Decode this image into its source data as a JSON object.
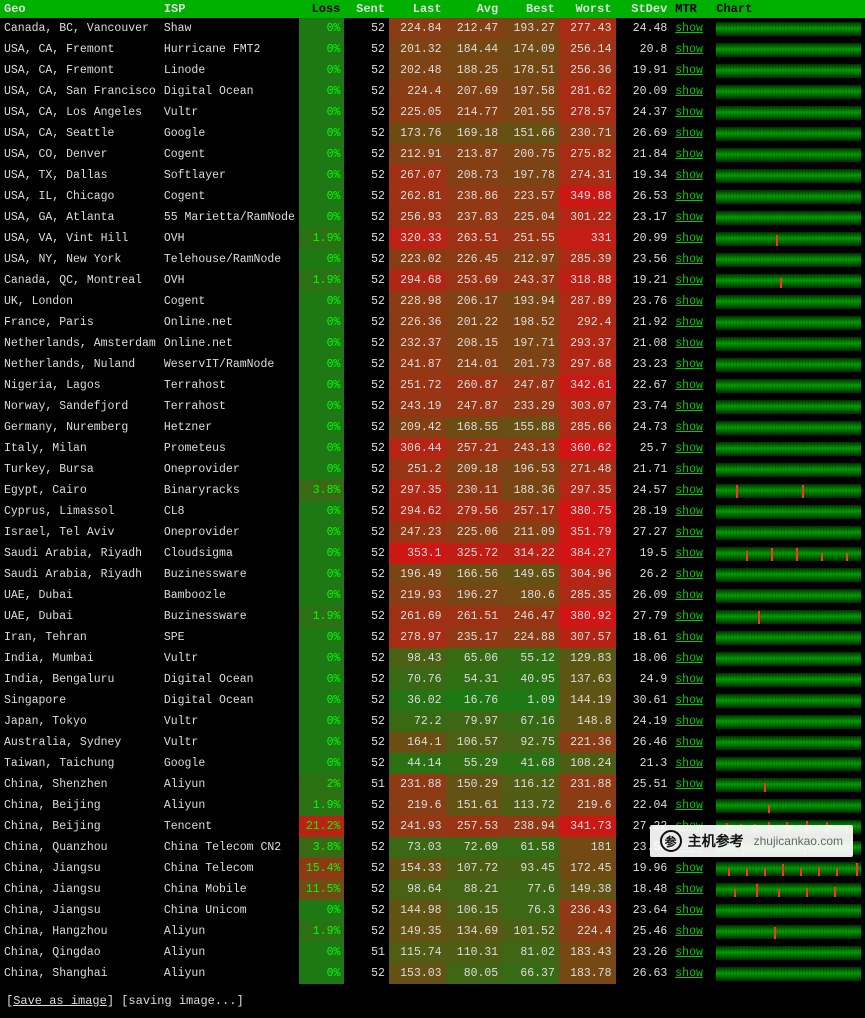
{
  "headers": {
    "geo": "Geo",
    "isp": "ISP",
    "loss": "Loss",
    "sent": "Sent",
    "last": "Last",
    "avg": "Avg",
    "best": "Best",
    "worst": "Worst",
    "stdev": "StDev",
    "mtr": "MTR",
    "chart": "Chart"
  },
  "mtr_label": "show",
  "footer": {
    "save": "Save as image",
    "status": "[saving image...]"
  },
  "watermark": {
    "name": "主机参考",
    "url": "zhujicankao.com"
  },
  "heat": {
    "loss": {
      "lo": 0,
      "hi": 25
    },
    "lat": {
      "lo": 20,
      "hi": 360
    }
  },
  "rows": [
    {
      "geo": "Canada, BC, Vancouver",
      "isp": "Shaw",
      "loss": "0%",
      "sent": "52",
      "last": "224.84",
      "avg": "212.47",
      "best": "193.27",
      "worst": "277.43",
      "stdev": "24.48",
      "spikes": []
    },
    {
      "geo": "USA, CA, Fremont",
      "isp": "Hurricane FMT2",
      "loss": "0%",
      "sent": "52",
      "last": "201.32",
      "avg": "184.44",
      "best": "174.09",
      "worst": "256.14",
      "stdev": "20.8",
      "spikes": []
    },
    {
      "geo": "USA, CA, Fremont",
      "isp": "Linode",
      "loss": "0%",
      "sent": "52",
      "last": "202.48",
      "avg": "188.25",
      "best": "178.51",
      "worst": "256.36",
      "stdev": "19.91",
      "spikes": []
    },
    {
      "geo": "USA, CA, San Francisco",
      "isp": "Digital Ocean",
      "loss": "0%",
      "sent": "52",
      "last": "224.4",
      "avg": "207.69",
      "best": "197.58",
      "worst": "281.62",
      "stdev": "20.09",
      "spikes": []
    },
    {
      "geo": "USA, CA, Los Angeles",
      "isp": "Vultr",
      "loss": "0%",
      "sent": "52",
      "last": "225.05",
      "avg": "214.77",
      "best": "201.55",
      "worst": "278.57",
      "stdev": "24.37",
      "spikes": []
    },
    {
      "geo": "USA, CA, Seattle",
      "isp": "Google",
      "loss": "0%",
      "sent": "52",
      "last": "173.76",
      "avg": "169.18",
      "best": "151.66",
      "worst": "230.71",
      "stdev": "26.69",
      "spikes": []
    },
    {
      "geo": "USA, CO, Denver",
      "isp": "Cogent",
      "loss": "0%",
      "sent": "52",
      "last": "212.91",
      "avg": "213.87",
      "best": "200.75",
      "worst": "275.82",
      "stdev": "21.84",
      "spikes": []
    },
    {
      "geo": "USA, TX, Dallas",
      "isp": "Softlayer",
      "loss": "0%",
      "sent": "52",
      "last": "267.07",
      "avg": "208.73",
      "best": "197.78",
      "worst": "274.31",
      "stdev": "19.34",
      "spikes": []
    },
    {
      "geo": "USA, IL, Chicago",
      "isp": "Cogent",
      "loss": "0%",
      "sent": "52",
      "last": "262.81",
      "avg": "238.86",
      "best": "223.57",
      "worst": "349.88",
      "stdev": "26.53",
      "spikes": []
    },
    {
      "geo": "USA, GA, Atlanta",
      "isp": "55 Marietta/RamNode",
      "loss": "0%",
      "sent": "52",
      "last": "256.93",
      "avg": "237.83",
      "best": "225.04",
      "worst": "301.22",
      "stdev": "23.17",
      "spikes": []
    },
    {
      "geo": "USA, VA, Vint Hill",
      "isp": "OVH",
      "loss": "1.9%",
      "sent": "52",
      "last": "320.33",
      "avg": "263.51",
      "best": "251.55",
      "worst": "331",
      "stdev": "20.99",
      "spikes": [
        60
      ]
    },
    {
      "geo": "USA, NY, New York",
      "isp": "Telehouse/RamNode",
      "loss": "0%",
      "sent": "52",
      "last": "223.02",
      "avg": "226.45",
      "best": "212.97",
      "worst": "285.39",
      "stdev": "23.56",
      "spikes": []
    },
    {
      "geo": "Canada, QC, Montreal",
      "isp": "OVH",
      "loss": "1.9%",
      "sent": "52",
      "last": "294.68",
      "avg": "253.69",
      "best": "243.37",
      "worst": "318.88",
      "stdev": "19.21",
      "spikes": [
        64
      ]
    },
    {
      "geo": "UK, London",
      "isp": "Cogent",
      "loss": "0%",
      "sent": "52",
      "last": "228.98",
      "avg": "206.17",
      "best": "193.94",
      "worst": "287.89",
      "stdev": "23.76",
      "spikes": []
    },
    {
      "geo": "France, Paris",
      "isp": "Online.net",
      "loss": "0%",
      "sent": "52",
      "last": "226.36",
      "avg": "201.22",
      "best": "198.52",
      "worst": "292.4",
      "stdev": "21.92",
      "spikes": []
    },
    {
      "geo": "Netherlands, Amsterdam",
      "isp": "Online.net",
      "loss": "0%",
      "sent": "52",
      "last": "232.37",
      "avg": "208.15",
      "best": "197.71",
      "worst": "293.37",
      "stdev": "21.08",
      "spikes": []
    },
    {
      "geo": "Netherlands, Nuland",
      "isp": "WeservIT/RamNode",
      "loss": "0%",
      "sent": "52",
      "last": "241.87",
      "avg": "214.01",
      "best": "201.73",
      "worst": "297.68",
      "stdev": "23.23",
      "spikes": []
    },
    {
      "geo": "Nigeria, Lagos",
      "isp": "Terrahost",
      "loss": "0%",
      "sent": "52",
      "last": "251.72",
      "avg": "260.87",
      "best": "247.87",
      "worst": "342.61",
      "stdev": "22.67",
      "spikes": []
    },
    {
      "geo": "Norway, Sandefjord",
      "isp": "Terrahost",
      "loss": "0%",
      "sent": "52",
      "last": "243.19",
      "avg": "247.87",
      "best": "233.29",
      "worst": "303.07",
      "stdev": "23.74",
      "spikes": []
    },
    {
      "geo": "Germany, Nuremberg",
      "isp": "Hetzner",
      "loss": "0%",
      "sent": "52",
      "last": "209.42",
      "avg": "168.55",
      "best": "155.88",
      "worst": "285.66",
      "stdev": "24.73",
      "spikes": []
    },
    {
      "geo": "Italy, Milan",
      "isp": "Prometeus",
      "loss": "0%",
      "sent": "52",
      "last": "306.44",
      "avg": "257.21",
      "best": "243.13",
      "worst": "360.62",
      "stdev": "25.7",
      "spikes": [
        158
      ]
    },
    {
      "geo": "Turkey, Bursa",
      "isp": "Oneprovider",
      "loss": "0%",
      "sent": "52",
      "last": "251.2",
      "avg": "209.18",
      "best": "196.53",
      "worst": "271.48",
      "stdev": "21.71",
      "spikes": []
    },
    {
      "geo": "Egypt, Cairo",
      "isp": "Binaryracks",
      "loss": "3.8%",
      "sent": "52",
      "last": "297.35",
      "avg": "230.11",
      "best": "188.36",
      "worst": "297.35",
      "stdev": "24.57",
      "spikes": [
        20,
        86
      ]
    },
    {
      "geo": "Cyprus, Limassol",
      "isp": "CL8",
      "loss": "0%",
      "sent": "52",
      "last": "294.62",
      "avg": "279.56",
      "best": "257.17",
      "worst": "380.75",
      "stdev": "28.19",
      "spikes": []
    },
    {
      "geo": "Israel, Tel Aviv",
      "isp": "Oneprovider",
      "loss": "0%",
      "sent": "52",
      "last": "247.23",
      "avg": "225.06",
      "best": "211.09",
      "worst": "351.79",
      "stdev": "27.27",
      "spikes": []
    },
    {
      "geo": "Saudi Arabia, Riyadh",
      "isp": "Cloudsigma",
      "loss": "0%",
      "sent": "52",
      "last": "353.1",
      "avg": "325.72",
      "best": "314.22",
      "worst": "384.27",
      "stdev": "19.5",
      "spikes": [
        30,
        55,
        80,
        105,
        130
      ]
    },
    {
      "geo": "Saudi Arabia, Riyadh",
      "isp": "Buzinessware",
      "loss": "0%",
      "sent": "52",
      "last": "196.49",
      "avg": "166.56",
      "best": "149.65",
      "worst": "304.96",
      "stdev": "26.2",
      "spikes": []
    },
    {
      "geo": "UAE, Dubai",
      "isp": "Bamboozle",
      "loss": "0%",
      "sent": "52",
      "last": "219.93",
      "avg": "196.27",
      "best": "180.6",
      "worst": "285.35",
      "stdev": "26.09",
      "spikes": []
    },
    {
      "geo": "UAE, Dubai",
      "isp": "Buzinessware",
      "loss": "1.9%",
      "sent": "52",
      "last": "261.69",
      "avg": "261.51",
      "best": "246.47",
      "worst": "380.92",
      "stdev": "27.79",
      "spikes": [
        42
      ]
    },
    {
      "geo": "Iran, Tehran",
      "isp": "SPE",
      "loss": "0%",
      "sent": "52",
      "last": "278.97",
      "avg": "235.17",
      "best": "224.88",
      "worst": "307.57",
      "stdev": "18.61",
      "spikes": []
    },
    {
      "geo": "India, Mumbai",
      "isp": "Vultr",
      "loss": "0%",
      "sent": "52",
      "last": "98.43",
      "avg": "65.06",
      "best": "55.12",
      "worst": "129.83",
      "stdev": "18.06",
      "spikes": []
    },
    {
      "geo": "India, Bengaluru",
      "isp": "Digital Ocean",
      "loss": "0%",
      "sent": "52",
      "last": "70.76",
      "avg": "54.31",
      "best": "40.95",
      "worst": "137.63",
      "stdev": "24.9",
      "spikes": []
    },
    {
      "geo": "Singapore",
      "isp": "Digital Ocean",
      "loss": "0%",
      "sent": "52",
      "last": "36.02",
      "avg": "16.76",
      "best": "1.09",
      "worst": "144.19",
      "stdev": "30.61",
      "spikes": []
    },
    {
      "geo": "Japan, Tokyo",
      "isp": "Vultr",
      "loss": "0%",
      "sent": "52",
      "last": "72.2",
      "avg": "79.97",
      "best": "67.16",
      "worst": "148.8",
      "stdev": "24.19",
      "spikes": []
    },
    {
      "geo": "Australia, Sydney",
      "isp": "Vultr",
      "loss": "0%",
      "sent": "52",
      "last": "164.1",
      "avg": "106.57",
      "best": "92.75",
      "worst": "221.36",
      "stdev": "26.46",
      "spikes": []
    },
    {
      "geo": "Taiwan, Taichung",
      "isp": "Google",
      "loss": "0%",
      "sent": "52",
      "last": "44.14",
      "avg": "55.29",
      "best": "41.68",
      "worst": "108.24",
      "stdev": "21.3",
      "spikes": []
    },
    {
      "geo": "China, Shenzhen",
      "isp": "Aliyun",
      "loss": "2%",
      "sent": "51",
      "last": "231.88",
      "avg": "150.29",
      "best": "116.12",
      "worst": "231.88",
      "stdev": "25.51",
      "spikes": [
        48
      ]
    },
    {
      "geo": "China, Beijing",
      "isp": "Aliyun",
      "loss": "1.9%",
      "sent": "52",
      "last": "219.6",
      "avg": "151.61",
      "best": "113.72",
      "worst": "219.6",
      "stdev": "22.04",
      "spikes": [
        52
      ]
    },
    {
      "geo": "China, Beijing",
      "isp": "Tencent",
      "loss": "21.2%",
      "sent": "52",
      "last": "241.93",
      "avg": "257.53",
      "best": "238.94",
      "worst": "341.73",
      "stdev": "27.22",
      "spikes": [
        10,
        24,
        38,
        52,
        70,
        90,
        110,
        130,
        150
      ]
    },
    {
      "geo": "China, Quanzhou",
      "isp": "China Telecom CN2",
      "loss": "3.8%",
      "sent": "52",
      "last": "73.03",
      "avg": "72.69",
      "best": "61.58",
      "worst": "181",
      "stdev": "23.58",
      "spikes": [
        26,
        88
      ]
    },
    {
      "geo": "China, Jiangsu",
      "isp": "China Telecom",
      "loss": "15.4%",
      "sent": "52",
      "last": "154.33",
      "avg": "107.72",
      "best": "93.45",
      "worst": "172.45",
      "stdev": "19.96",
      "spikes": [
        12,
        30,
        48,
        66,
        84,
        102,
        120,
        140
      ]
    },
    {
      "geo": "China, Jiangsu",
      "isp": "China Mobile",
      "loss": "11.5%",
      "sent": "52",
      "last": "98.64",
      "avg": "88.21",
      "best": "77.6",
      "worst": "149.38",
      "stdev": "18.48",
      "spikes": [
        18,
        40,
        62,
        90,
        118,
        145
      ]
    },
    {
      "geo": "China, Jiangsu",
      "isp": "China Unicom",
      "loss": "0%",
      "sent": "52",
      "last": "144.98",
      "avg": "106.15",
      "best": "76.3",
      "worst": "236.43",
      "stdev": "23.64",
      "spikes": []
    },
    {
      "geo": "China, Hangzhou",
      "isp": "Aliyun",
      "loss": "1.9%",
      "sent": "52",
      "last": "149.35",
      "avg": "134.69",
      "best": "101.52",
      "worst": "224.4",
      "stdev": "25.46",
      "spikes": [
        58
      ]
    },
    {
      "geo": "China, Qingdao",
      "isp": "Aliyun",
      "loss": "0%",
      "sent": "51",
      "last": "115.74",
      "avg": "110.31",
      "best": "81.02",
      "worst": "183.43",
      "stdev": "23.26",
      "spikes": []
    },
    {
      "geo": "China, Shanghai",
      "isp": "Aliyun",
      "loss": "0%",
      "sent": "52",
      "last": "153.03",
      "avg": "80.05",
      "best": "66.37",
      "worst": "183.78",
      "stdev": "26.63",
      "spikes": []
    }
  ]
}
